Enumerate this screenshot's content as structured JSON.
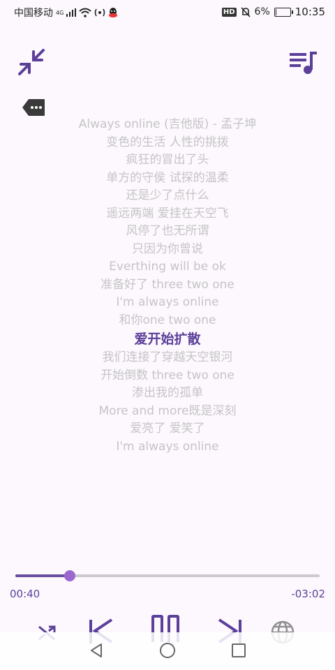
{
  "status": {
    "carrier": "中国移动",
    "network": "4G",
    "hd_badge": "HD",
    "battery": "6%",
    "battery_level": 0.06,
    "time": "10:35"
  },
  "lyrics": {
    "lines": [
      "Always online (吉他版) - 孟子坤",
      "变色的生活  人性的挑拨",
      "疯狂的冒出了头",
      "单方的守侯  试探的温柔",
      "还是少了点什么",
      "遥远两端 爱挂在天空飞",
      "风停了也无所谓",
      "只因为你曾说",
      "Everthing will be ok",
      "准备好了 three two one",
      "I'm always online",
      "和你one two one",
      "爱开始扩散",
      "我们连接了穿越天空银河",
      "开始倒数  three two one",
      "渗出我的孤单",
      "More and more既是深刻",
      "爱亮了 爱笑了",
      "I'm always online"
    ],
    "active_index": 12
  },
  "player": {
    "elapsed": "00:40",
    "remaining": "-03:02",
    "progress": 0.18
  },
  "colors": {
    "accent": "#5b3f99",
    "knob": "#9b67cf",
    "inactive_lyric": "#c6c4c7",
    "background": "#fcf8fd"
  },
  "icons": {
    "collapse": "collapse-arrows-icon",
    "playlist": "playlist-music-icon",
    "more": "more-tag-icon",
    "shuffle": "shuffle-icon",
    "previous": "skip-previous-icon",
    "pause": "pause-icon",
    "next": "skip-next-icon",
    "globe": "globe-icon"
  }
}
